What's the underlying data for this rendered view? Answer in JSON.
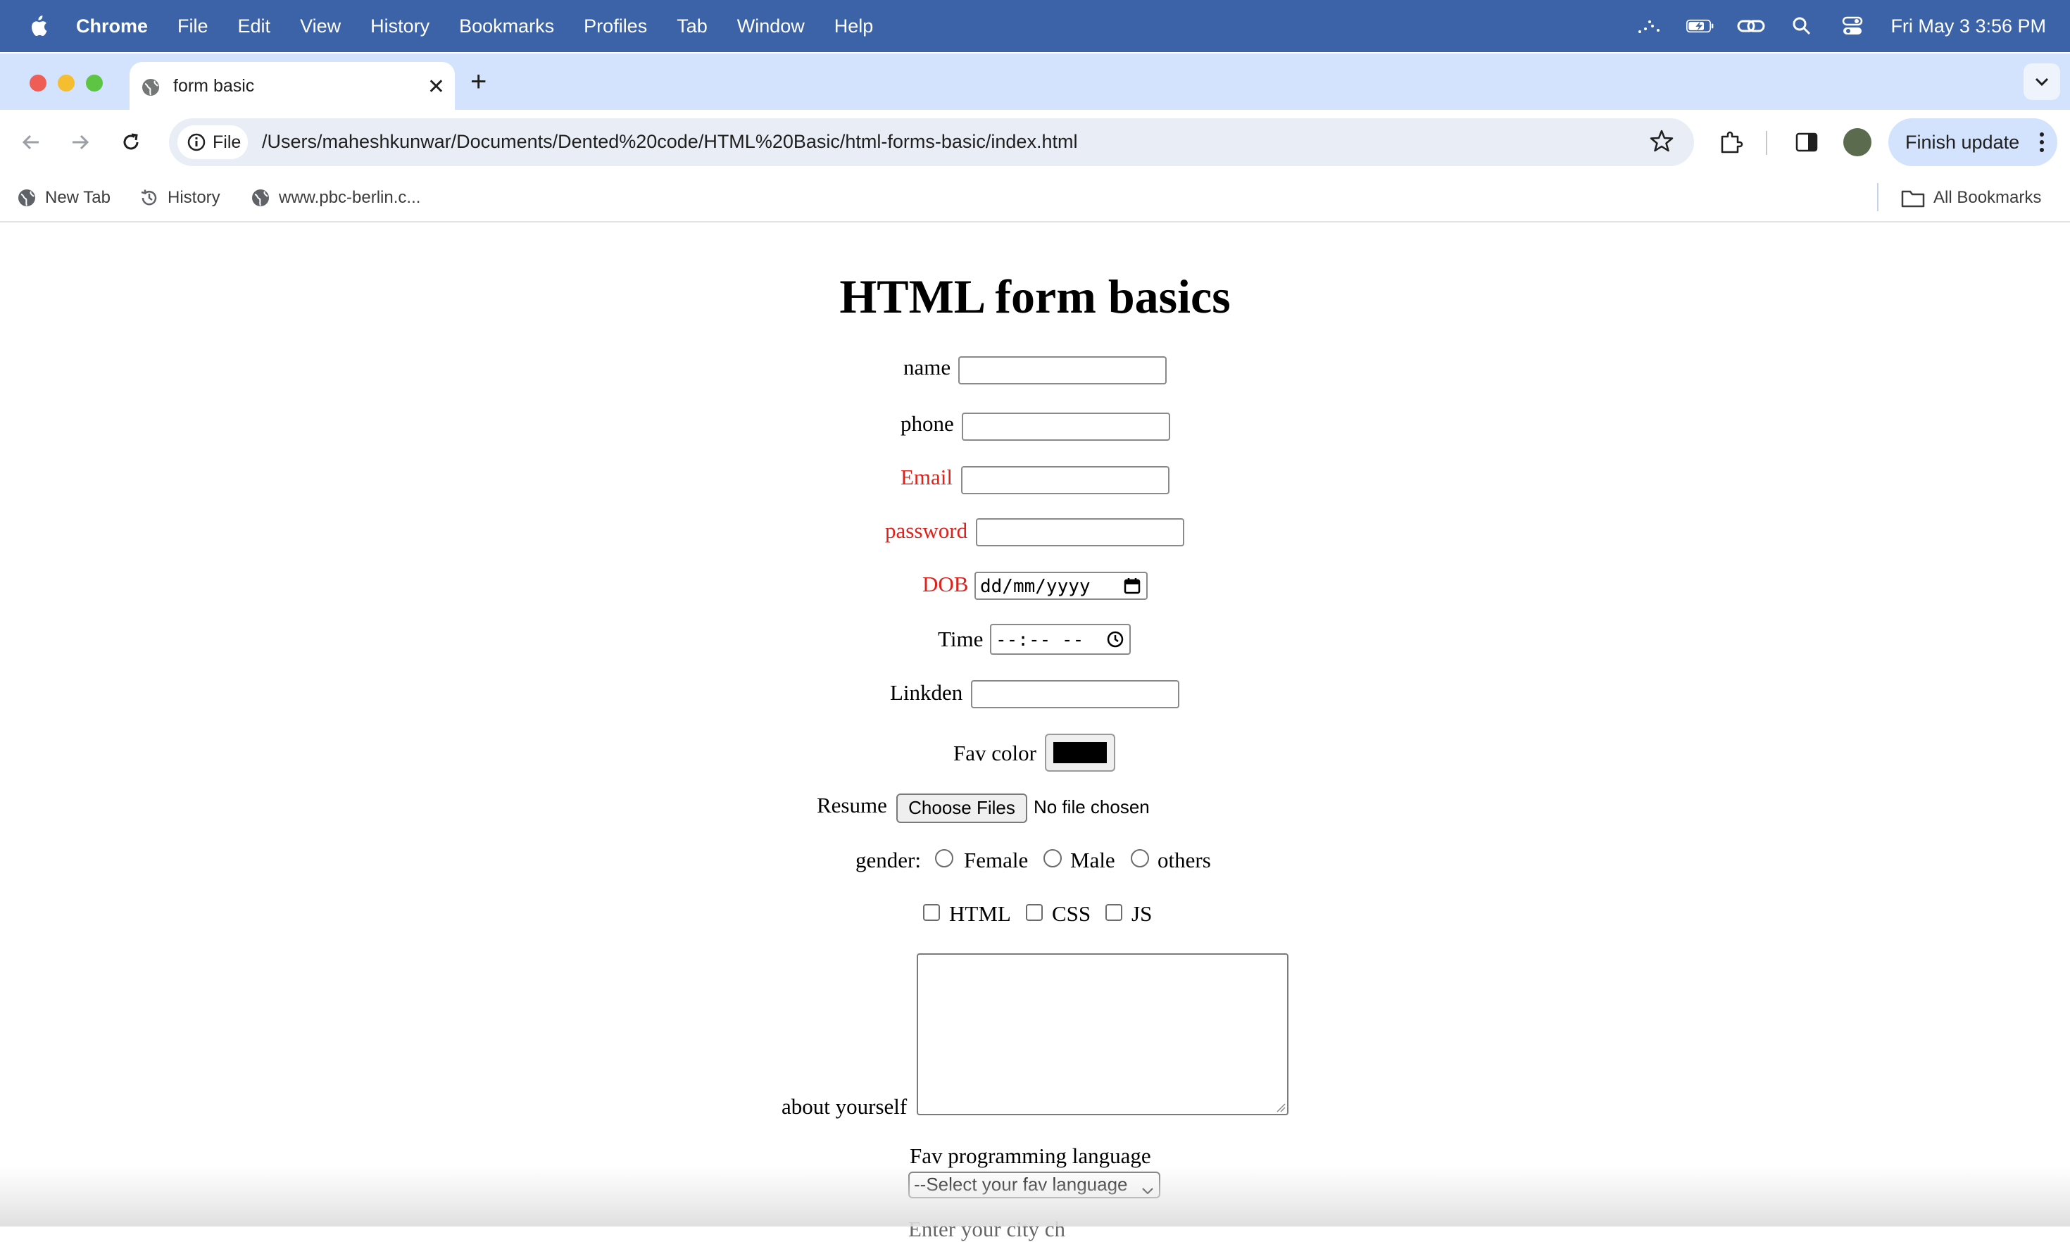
{
  "menubar": {
    "app": "Chrome",
    "items": [
      "File",
      "Edit",
      "View",
      "History",
      "Bookmarks",
      "Profiles",
      "Tab",
      "Window",
      "Help"
    ],
    "datetime": "Fri May 3  3:56 PM"
  },
  "tab": {
    "title": "form basic"
  },
  "omnibox": {
    "chip": "File",
    "url": "/Users/maheshkunwar/Documents/Dented%20code/HTML%20Basic/html-forms-basic/index.html"
  },
  "toolbar": {
    "finish_update": "Finish update"
  },
  "bookmarks": {
    "items": [
      "New Tab",
      "History",
      "www.pbc-berlin.c..."
    ],
    "all": "All Bookmarks"
  },
  "page": {
    "title": "HTML form basics",
    "labels": {
      "name": "name",
      "phone": "phone",
      "email": "Email",
      "password": "password",
      "dob": "DOB",
      "time": "Time",
      "linkden": "Linkden",
      "fav_color": "Fav color",
      "resume": "Resume",
      "gender": "gender:",
      "about": "about yourself",
      "fav_lang": "Fav programming language"
    },
    "dob_placeholder": "dd/mm/yyyy",
    "time_placeholder": "--:-- --",
    "fav_color_value": "#000000",
    "file_button": "Choose Files",
    "file_status": "No file chosen",
    "gender_options": [
      "Female",
      "Male",
      "others"
    ],
    "skills": [
      "HTML",
      "CSS",
      "JS"
    ],
    "select_value": "--Select your fav language",
    "partial_text": "Enter your city ch"
  },
  "colors": {
    "menubar": "#3c63a8",
    "tabstrip": "#d3e3fd",
    "required_label": "#e0201a"
  }
}
